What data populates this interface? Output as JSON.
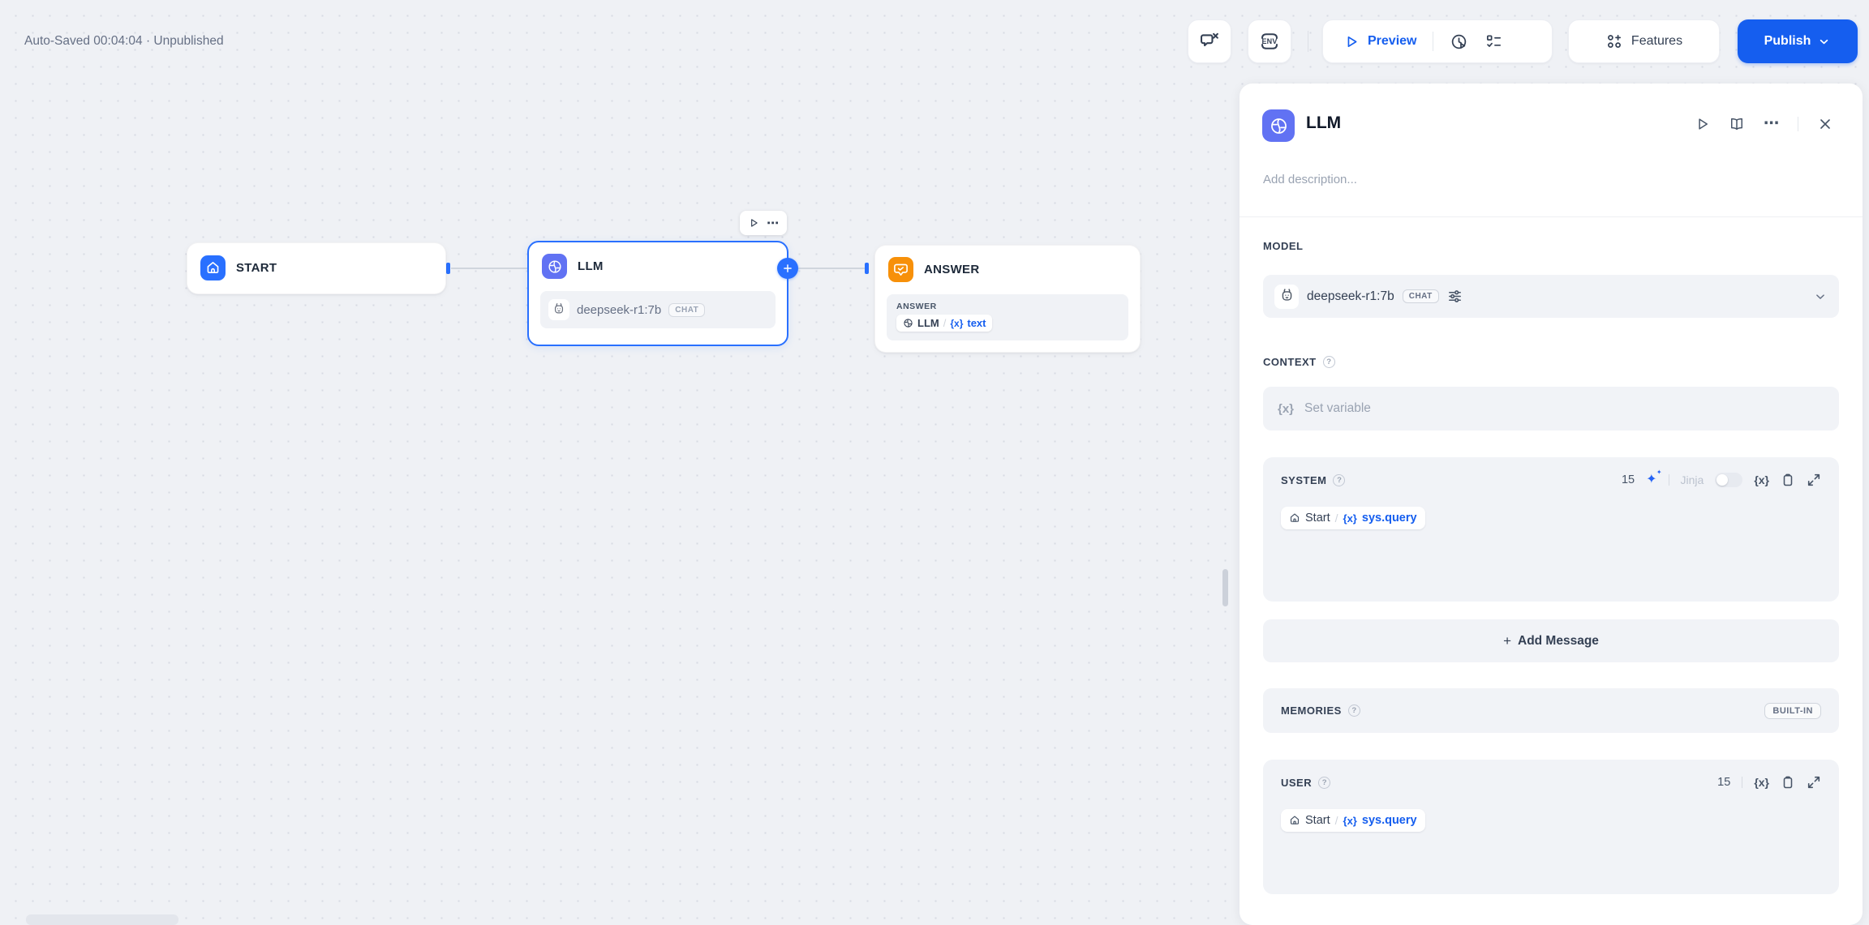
{
  "status_bar": {
    "autosave": "Auto-Saved 00:04:04 · Unpublished"
  },
  "top_toolbar": {
    "env_label": "ENV",
    "preview_label": "Preview",
    "features_label": "Features",
    "publish_label": "Publish"
  },
  "canvas": {
    "start_node": {
      "title": "START"
    },
    "llm_node": {
      "title": "LLM",
      "model": "deepseek-r1:7b",
      "mode": "CHAT"
    },
    "answer_node": {
      "title": "ANSWER",
      "output_label": "ANSWER",
      "ref_node": "LLM",
      "separator": "/",
      "ref_variable": "text"
    }
  },
  "panel": {
    "title": "LLM",
    "description_placeholder": "Add description...",
    "model_section": {
      "label": "MODEL",
      "model": "deepseek-r1:7b",
      "mode": "CHAT"
    },
    "context_section": {
      "label": "CONTEXT",
      "placeholder": "Set variable"
    },
    "system_section": {
      "label": "SYSTEM",
      "tokens": "15",
      "jinja_label": "Jinja",
      "chip": {
        "node": "Start",
        "separator": "/",
        "variable": "sys.query"
      }
    },
    "add_message": {
      "plus": "+",
      "label": "Add Message"
    },
    "memories_section": {
      "label": "MEMORIES",
      "badge": "BUILT-IN"
    },
    "user_section": {
      "label": "USER",
      "tokens": "15",
      "chip": {
        "node": "Start",
        "separator": "/",
        "variable": "sys.query"
      }
    }
  },
  "glyphs": {
    "variable": "{x}",
    "ellipsis": "⋯",
    "question": "?",
    "sparkle": "✦"
  },
  "colors": {
    "accent": "#155eef",
    "start_node": "#2970ff",
    "llm_node": "#6172f3",
    "answer_node": "#f79009"
  }
}
